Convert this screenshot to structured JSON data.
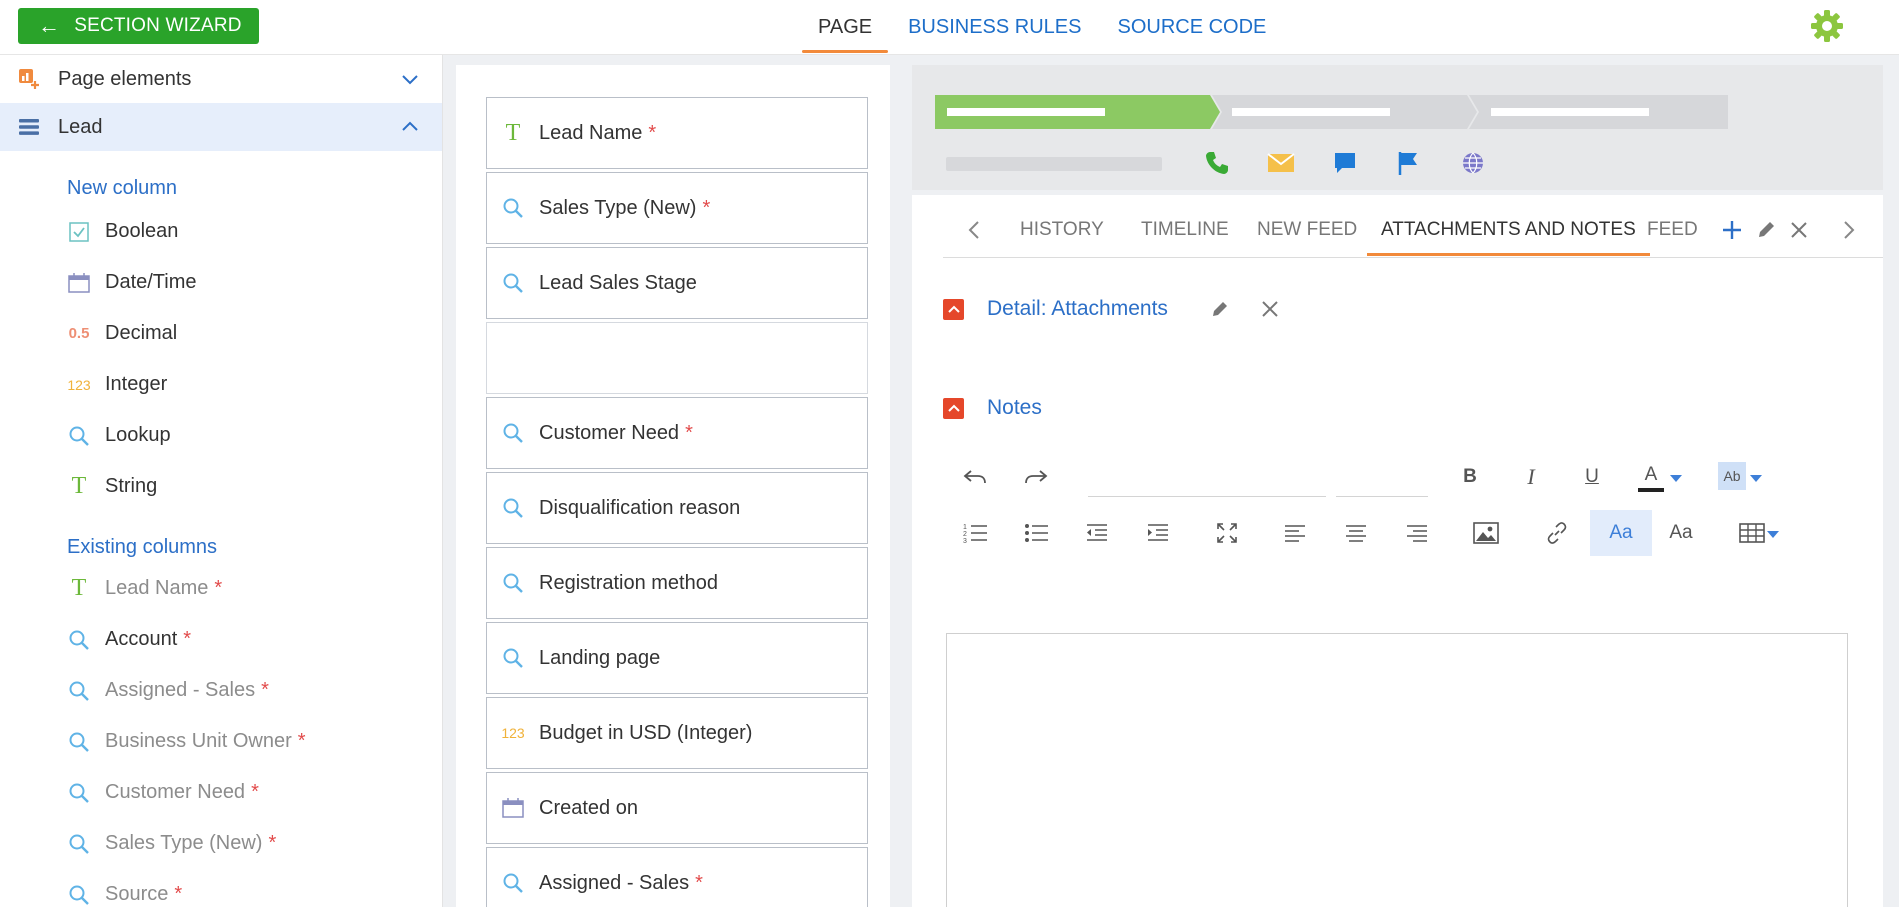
{
  "topbar": {
    "wizard_label": "SECTION WIZARD",
    "tabs": [
      {
        "label": "PAGE"
      },
      {
        "label": "BUSINESS RULES"
      },
      {
        "label": "SOURCE CODE"
      }
    ]
  },
  "left": {
    "groups": [
      {
        "label": "Page elements"
      },
      {
        "label": "Lead"
      }
    ],
    "new_column_title": "New column",
    "new_columns": [
      {
        "label": "Boolean",
        "icon": "checkbox-icon"
      },
      {
        "label": "Date/Time",
        "icon": "calendar-icon"
      },
      {
        "label": "Decimal",
        "icon": "decimal-icon",
        "glyph": "0.5"
      },
      {
        "label": "Integer",
        "icon": "integer-icon",
        "glyph": "123"
      },
      {
        "label": "Lookup",
        "icon": "search-icon"
      },
      {
        "label": "String",
        "icon": "text-icon",
        "glyph": "T"
      }
    ],
    "existing_columns_title": "Existing columns",
    "existing_columns": [
      {
        "label": "Lead Name",
        "required": "*"
      },
      {
        "label": "Account",
        "required": "*"
      },
      {
        "label": "Assigned - Sales",
        "required": "*"
      },
      {
        "label": "Business Unit Owner",
        "required": "*"
      },
      {
        "label": "Customer Need",
        "required": "*"
      },
      {
        "label": "Sales Type (New)",
        "required": "*"
      },
      {
        "label": "Source",
        "required": "*"
      }
    ]
  },
  "middle": {
    "fields": [
      {
        "label": "Lead Name",
        "required": "*"
      },
      {
        "label": "Sales Type (New)",
        "required": "*"
      },
      {
        "label": "Lead Sales Stage",
        "required": ""
      },
      {
        "label": "",
        "required": ""
      },
      {
        "label": "Customer Need",
        "required": "*"
      },
      {
        "label": "Disqualification reason",
        "required": ""
      },
      {
        "label": "Registration method",
        "required": ""
      },
      {
        "label": "Landing page",
        "required": ""
      },
      {
        "label": "Budget in USD (Integer)",
        "required": "",
        "glyph": "123"
      },
      {
        "label": "Created on",
        "required": ""
      },
      {
        "label": "Assigned - Sales",
        "required": "*"
      }
    ]
  },
  "right": {
    "tabs": [
      {
        "label": "HISTORY"
      },
      {
        "label": "TIMELINE"
      },
      {
        "label": "NEW FEED"
      },
      {
        "label": "ATTACHMENTS AND NOTES"
      },
      {
        "label": "FEED"
      }
    ],
    "detail_attachments": "Detail: Attachments",
    "notes": "Notes",
    "toolbar_glyphs": {
      "bold": "B",
      "italic": "I",
      "underline": "U",
      "font_color": "A",
      "highlight": "Ab",
      "font_size": "Aa",
      "font_family": "Aa"
    }
  },
  "colors": {
    "accent_green": "#2aa32a",
    "accent_orange": "#f28a3a",
    "link_blue": "#2c6fc7",
    "required_red": "#e24b4b",
    "collapse_red": "#e5472a"
  }
}
